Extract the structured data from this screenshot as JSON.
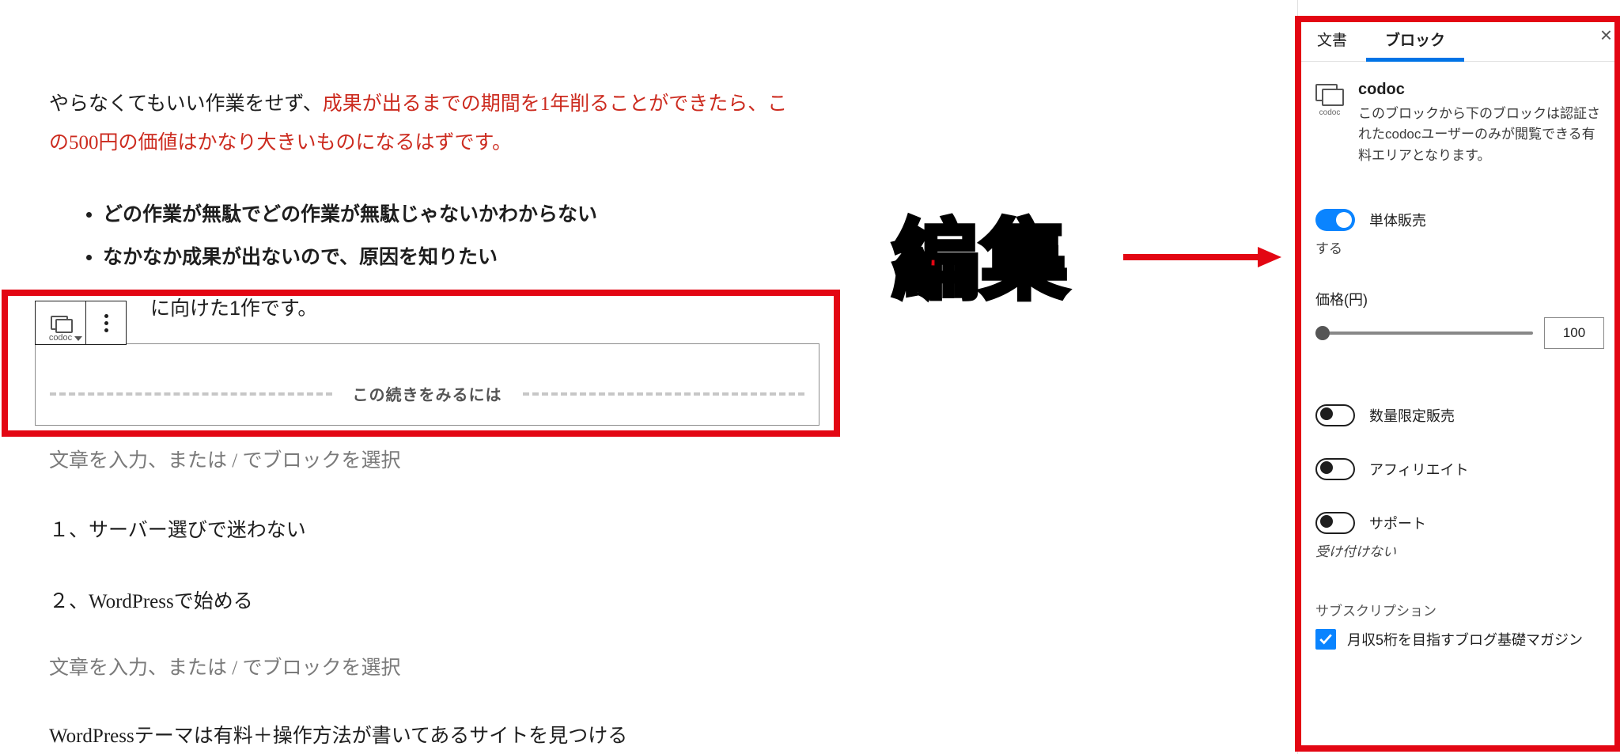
{
  "editor": {
    "para1_plain": "やらなくてもいい作業をせず、",
    "para1_red_a": "成果が出るまでの期間を1年削ることができたら、この500円の価値はかなり大きいものになるはずです。",
    "bullets": [
      "どの作業が無駄でどの作業が無駄じゃないかわからない",
      "なかなか成果が出ないので、原因を知りたい"
    ],
    "cropped_line": "に向けた1作です。",
    "codoc_divider_label": "この続きをみるには",
    "placeholder": "文章を入力、または / でブロックを選択",
    "h1": "１、サーバー選びで迷わない",
    "h2": "２、WordPressで始める",
    "last": "WordPressテーマは有料＋操作方法が書いてあるサイトを見つける"
  },
  "toolbar": {
    "codoc_label": "codoc"
  },
  "annotation": {
    "text": "編集"
  },
  "sidebar": {
    "tabs": {
      "doc": "文書",
      "block": "ブロック"
    },
    "block_name": "codoc",
    "block_desc": "このブロックから下のブロックは認証されたcodocユーザーのみが閲覧できる有料エリアとなります。",
    "single_sale": {
      "label": "単体販売",
      "sub": "する",
      "on": true
    },
    "price": {
      "label": "価格(円)",
      "value": "100"
    },
    "limited": {
      "label": "数量限定販売",
      "on": false
    },
    "affiliate": {
      "label": "アフィリエイト",
      "on": false
    },
    "support": {
      "label": "サポート",
      "on": false,
      "sub": "受け付けない"
    },
    "subscription": {
      "label": "サブスクリプション",
      "item": "月収5桁を目指すブログ基礎マガジン",
      "checked": true
    }
  }
}
